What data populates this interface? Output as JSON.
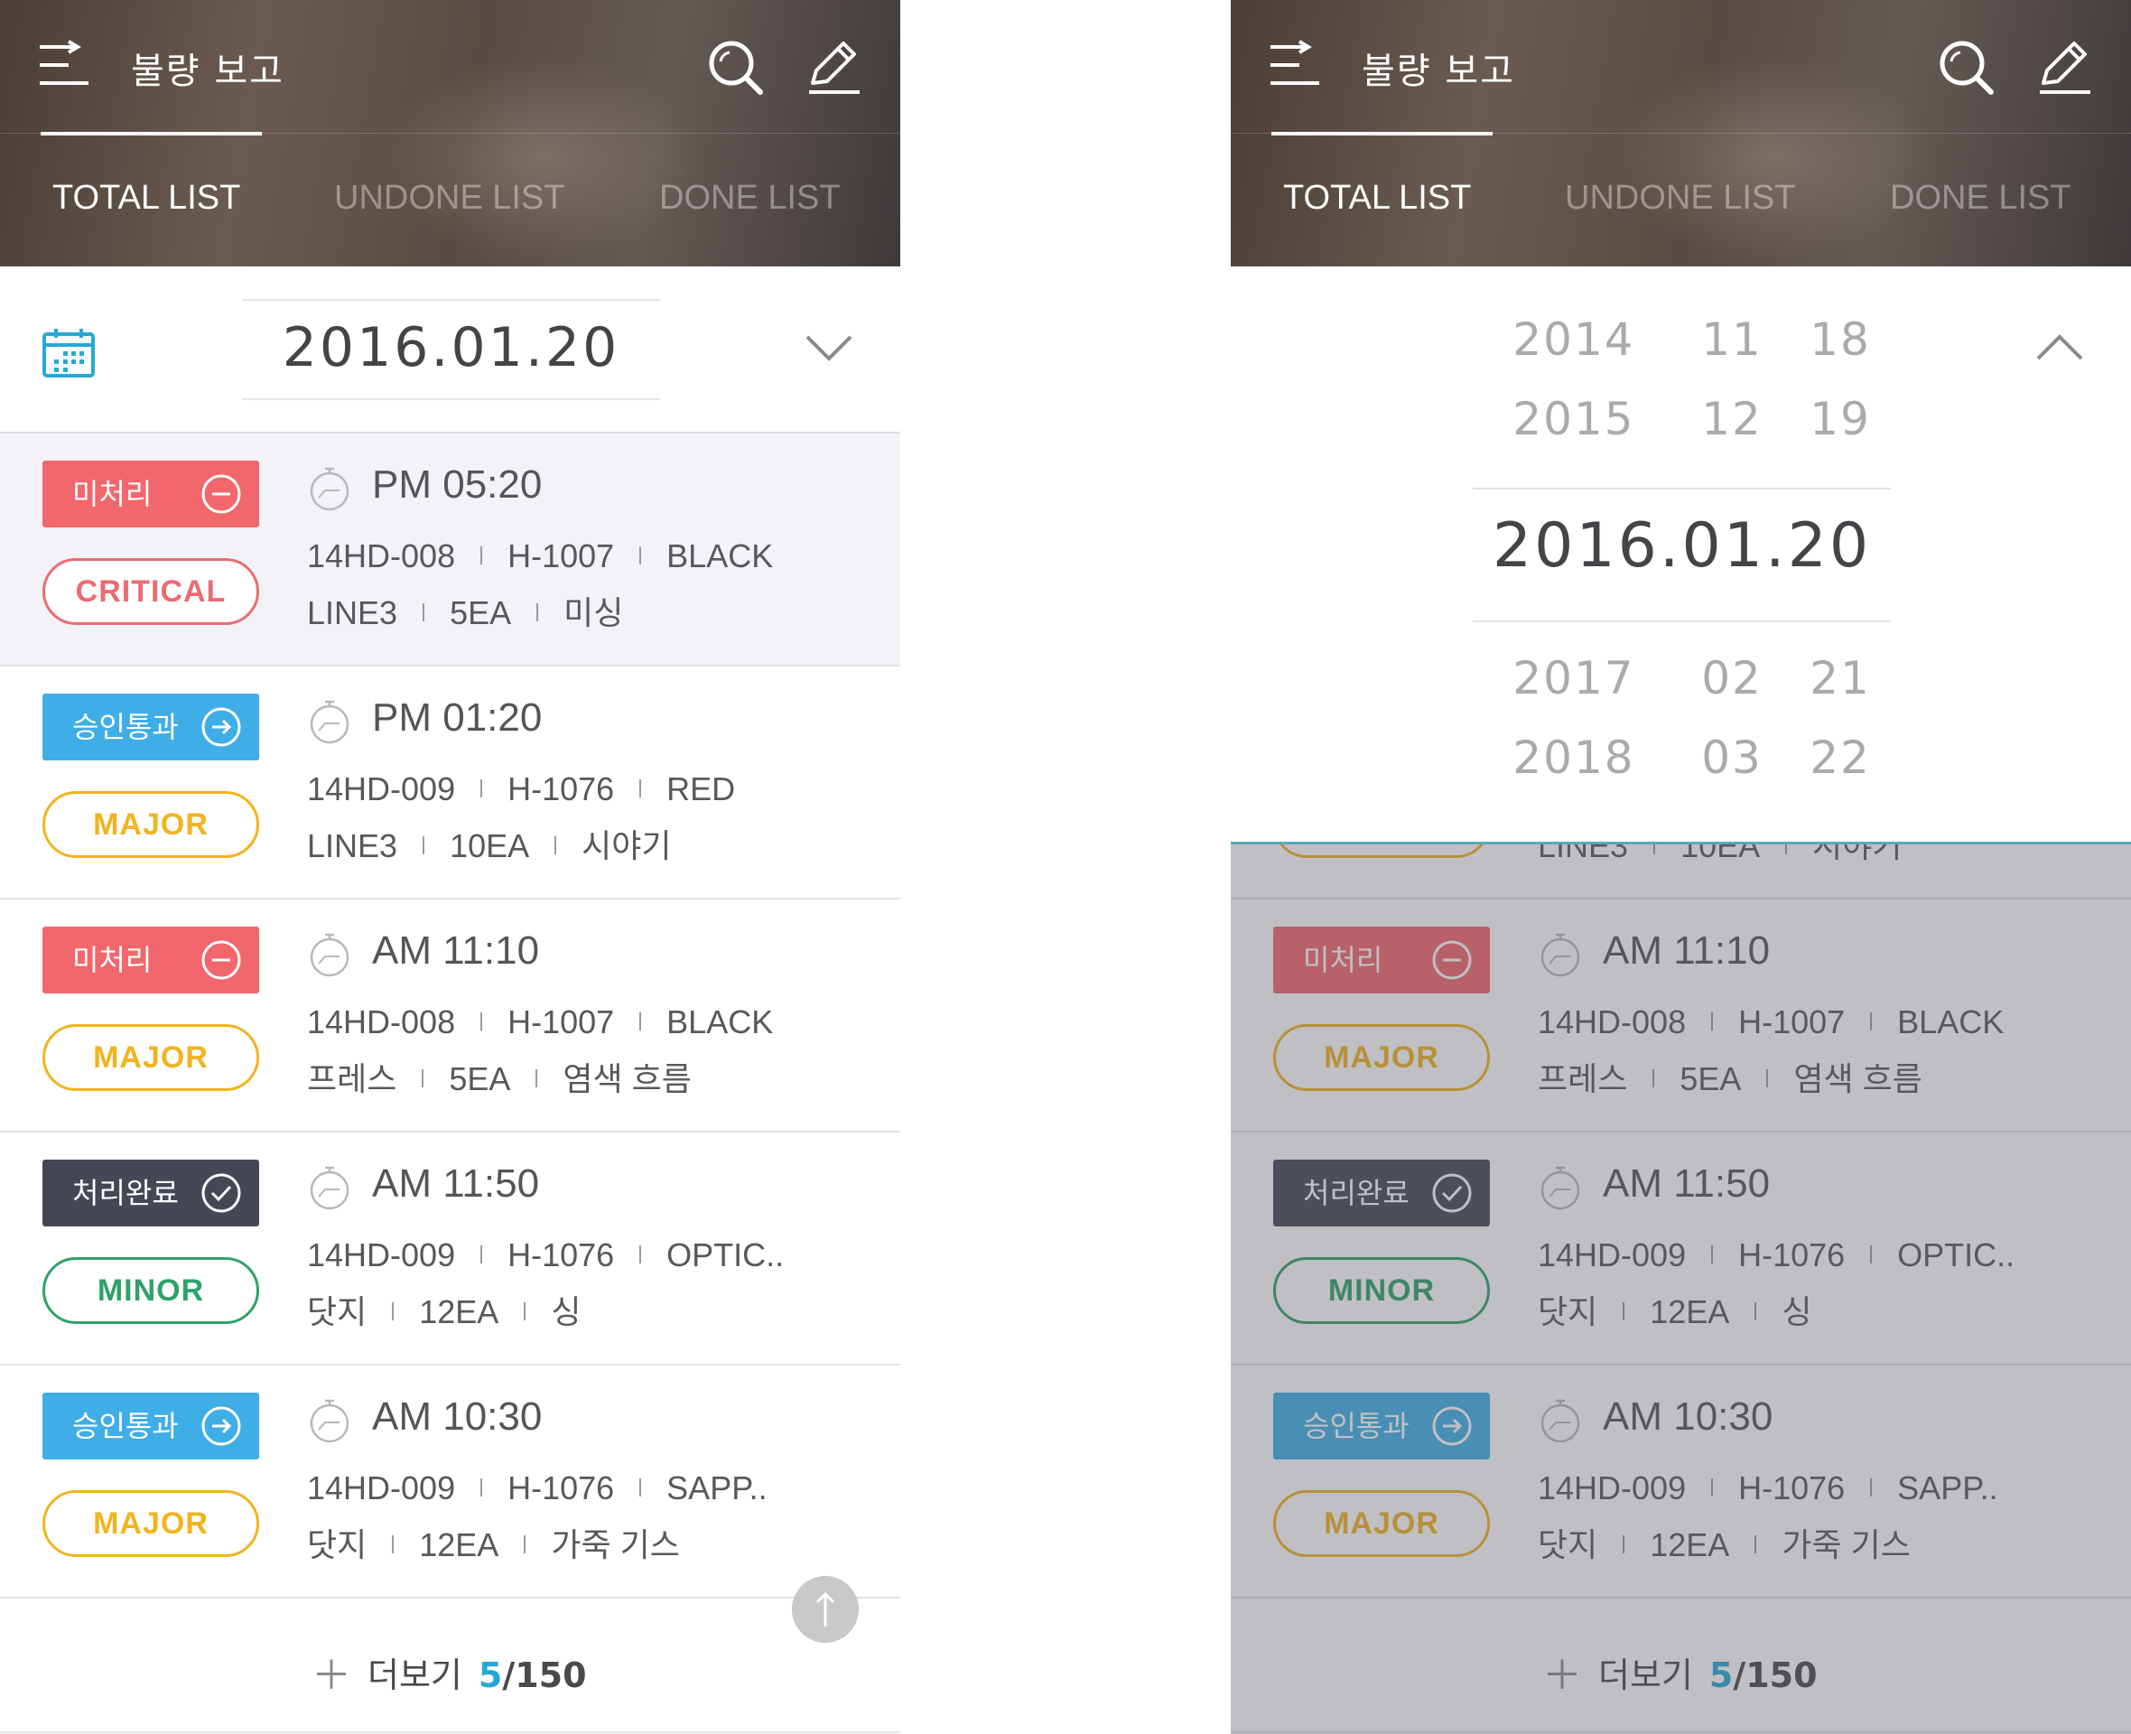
{
  "app_title": "불량 보고",
  "tabs": [
    "TOTAL LIST",
    "UNDONE LIST",
    "DONE LIST"
  ],
  "selected_date": "2016.01.20",
  "colors": {
    "status_unprocessed": "#f2676c",
    "status_approved": "#3faee6",
    "status_done": "#454854",
    "critical": "#ee6a70",
    "major": "#f1b41f",
    "minor": "#2fa269",
    "accent": "#27a8d4"
  },
  "icons": [
    "menu-icon",
    "search-icon",
    "edit-icon",
    "calendar-icon",
    "chevron-down-icon",
    "clock-icon",
    "arrow-up-icon"
  ],
  "items": [
    {
      "status": "미처리",
      "severity": "CRITICAL",
      "time": "PM 05:20",
      "code": "14HD-008",
      "part": "H-1007",
      "color": "BLACK",
      "line": "LINE3",
      "qty": "5EA",
      "defect": "미싱"
    },
    {
      "status": "승인통과",
      "severity": "MAJOR",
      "time": "PM 01:20",
      "code": "14HD-009",
      "part": "H-1076",
      "color": "RED",
      "line": "LINE3",
      "qty": "10EA",
      "defect": "시야기"
    },
    {
      "status": "미처리",
      "severity": "MAJOR",
      "time": "AM 11:10",
      "code": "14HD-008",
      "part": "H-1007",
      "color": "BLACK",
      "line": "프레스",
      "qty": "5EA",
      "defect": "염색 흐름"
    },
    {
      "status": "처리완료",
      "severity": "MINOR",
      "time": "AM 11:50",
      "code": "14HD-009",
      "part": "H-1076",
      "color": "OPTIC..",
      "line": "닷지",
      "qty": "12EA",
      "defect": "싱"
    },
    {
      "status": "승인통과",
      "severity": "MAJOR",
      "time": "AM 10:30",
      "code": "14HD-009",
      "part": "H-1076",
      "color": "SAPP..",
      "line": "닷지",
      "qty": "12EA",
      "defect": "가죽 기스"
    }
  ],
  "more": {
    "label": "더보기",
    "current": "5",
    "total": "/150"
  },
  "picker": {
    "years_above": [
      "2014",
      "2015"
    ],
    "months_above": [
      "11",
      "12"
    ],
    "days_above": [
      "18",
      "19"
    ],
    "selected": "2016.01.20",
    "years_below": [
      "2017",
      "2018"
    ],
    "months_below": [
      "02",
      "03"
    ],
    "days_below": [
      "21",
      "22"
    ]
  }
}
